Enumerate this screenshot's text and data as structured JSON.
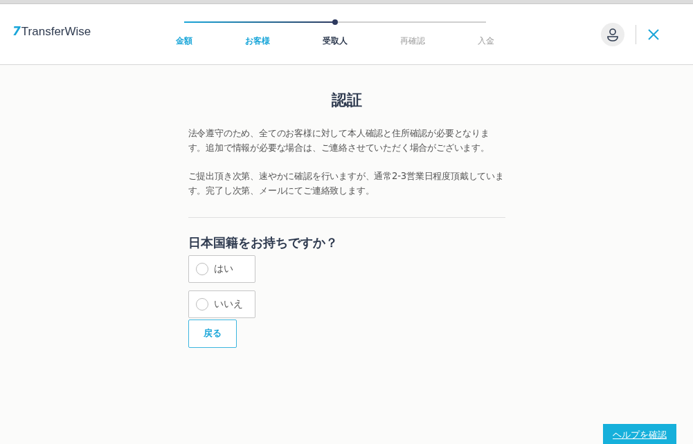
{
  "header": {
    "logo_mark": "7",
    "logo_text": "TransferWise",
    "progress": {
      "level": 0.5
    },
    "steps": [
      {
        "label": "金額",
        "kind": "done"
      },
      {
        "label": "お客様",
        "kind": "done"
      },
      {
        "label": "受取人",
        "kind": "current"
      },
      {
        "label": "再確認",
        "kind": "todo"
      },
      {
        "label": "入金",
        "kind": "todo"
      }
    ]
  },
  "title": "認証",
  "paragraphs": [
    "法令遵守のため、全てのお客様に対して本人確認と住所確認が必要となります。追加で情報が必要な場合は、ご連絡させていただく場合がございます。",
    "ご提出頂き次第、速やかに確認を行いますが、通常2-3営業日程度頂戴しています。完了し次第、メールにてご連絡致します。"
  ],
  "question": "日本国籍をお持ちですか？",
  "options": [
    {
      "label": "はい",
      "selected": false
    },
    {
      "label": "いいえ",
      "selected": false
    }
  ],
  "back_button": "戻る",
  "help_button": "ヘルプを確認"
}
